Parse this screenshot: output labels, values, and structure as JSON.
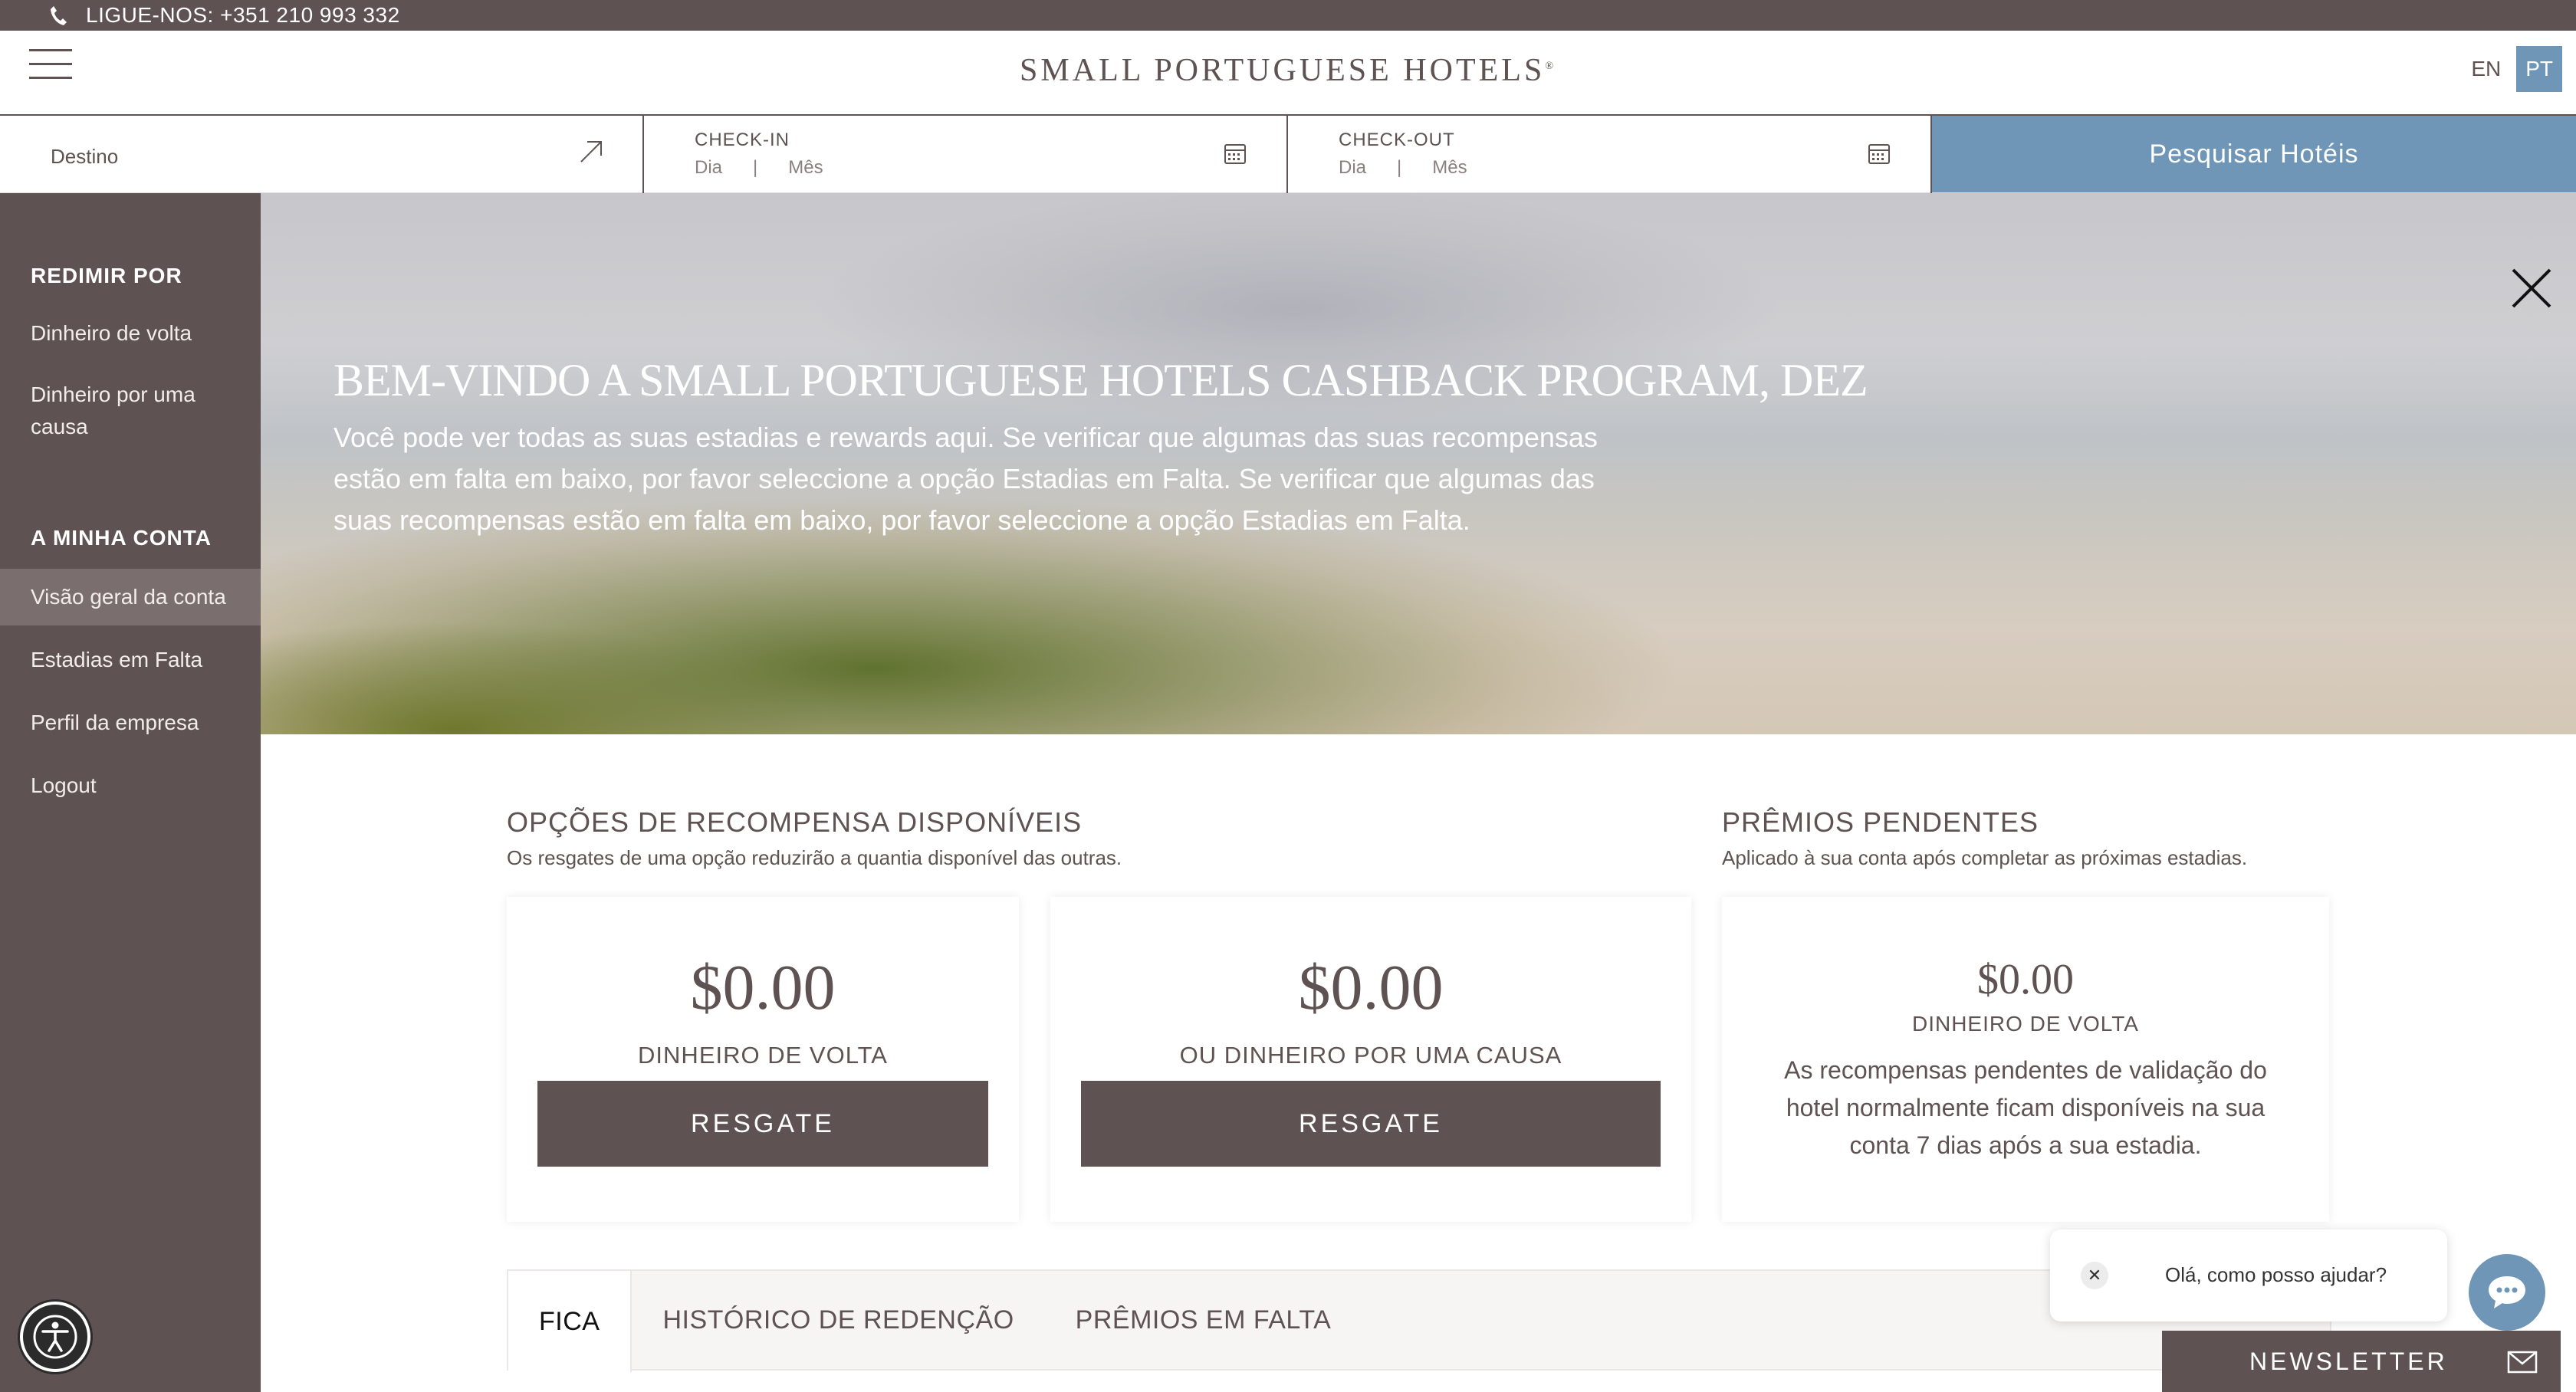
{
  "topbar": {
    "phone_text": "LIGUE-NOS: +351 210 993 332"
  },
  "header": {
    "logo": "SMALL PORTUGUESE HOTELS",
    "logo_mark": "®",
    "lang_en": "EN",
    "lang_pt": "PT"
  },
  "search": {
    "destination_label": "Destino",
    "checkin_label": "CHECK-IN",
    "checkin_day": "Dia",
    "checkin_sep": "|",
    "checkin_month": "Mês",
    "checkout_label": "CHECK-OUT",
    "checkout_day": "Dia",
    "checkout_sep": "|",
    "checkout_month": "Mês",
    "button_label": "Pesquisar Hotéis"
  },
  "sidebar": {
    "section1_title": "REDIMIR POR",
    "section1_items": [
      {
        "label": "Dinheiro de volta"
      },
      {
        "label": "Dinheiro por uma causa"
      }
    ],
    "section2_title": "A MINHA CONTA",
    "section2_items": [
      {
        "label": "Visão geral da conta",
        "active": true
      },
      {
        "label": "Estadias em Falta"
      },
      {
        "label": "Perfil da empresa"
      },
      {
        "label": "Logout"
      }
    ]
  },
  "hero": {
    "title": "BEM-VINDO A SMALL PORTUGUESE HOTELS CASHBACK PROGRAM, DEZ",
    "text": "Você pode ver todas as suas estadias e rewards aqui. Se verificar que algumas das suas recompensas estão em falta em baixo, por favor seleccione a opção Estadias em Falta. Se verificar que algumas das suas recompensas estão em falta em baixo, por favor seleccione a opção Estadias em Falta."
  },
  "rewards": {
    "title": "OPÇÕES DE RECOMPENSA DISPONÍVEIS",
    "subtitle": "Os resgates de uma opção reduzirão a quantia disponível das outras.",
    "cards": [
      {
        "amount": "$0.00",
        "caption": "DINHEIRO DE VOLTA",
        "button": "RESGATE"
      },
      {
        "amount": "$0.00",
        "caption": "OU DINHEIRO POR UMA CAUSA",
        "button": "RESGATE"
      }
    ]
  },
  "pending": {
    "title": "PRÊMIOS PENDENTES",
    "subtitle": "Aplicado à sua conta após completar as próximas estadias.",
    "amount": "$0.00",
    "caption": "DINHEIRO DE VOLTA",
    "note": "As recompensas pendentes de validação do hotel normalmente ficam disponíveis na sua conta 7 dias após a sua estadia."
  },
  "tabs": [
    {
      "label": "FICA",
      "active": true
    },
    {
      "label": "HISTÓRICO DE REDENÇÃO"
    },
    {
      "label": "PRÊMIOS EM FALTA"
    }
  ],
  "chat": {
    "message": "Olá, como posso ajudar?",
    "close_glyph": "✕"
  },
  "newsletter": {
    "label": "NEWSLETTER"
  },
  "colors": {
    "brown": "#5e5352",
    "blue": "#6f96b7"
  }
}
